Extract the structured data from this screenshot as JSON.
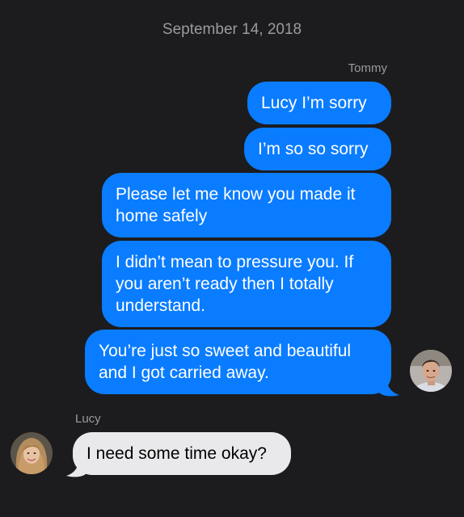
{
  "conversation": {
    "date": "September 14, 2018",
    "outgoing_sender": "Tommy",
    "incoming_sender": "Lucy",
    "outgoing_messages": [
      "Lucy I’m sorry",
      "I’m so so sorry",
      "Please let me know you made it home safely",
      "I didn’t mean to pressure you. If you aren’t ready then I totally understand.",
      "You’re just so sweet and beautiful and I got carried away."
    ],
    "incoming_messages": [
      "I need some time okay?"
    ]
  },
  "colors": {
    "background": "#1c1c1e",
    "outgoing_bubble": "#0a7cff",
    "incoming_bubble": "#e9e9eb",
    "meta_text": "#9a9aa0"
  },
  "icons": {
    "tommy_avatar": "avatar-icon",
    "lucy_avatar": "avatar-icon"
  }
}
